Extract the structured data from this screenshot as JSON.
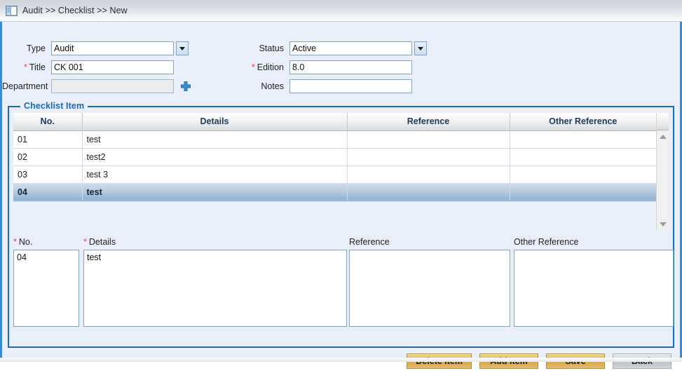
{
  "header": {
    "icon": "window-panel-icon",
    "breadcrumb": "Audit >> Checklist >> New"
  },
  "form": {
    "type": {
      "label": "Type",
      "value": "Audit",
      "required": false,
      "dropdown": true
    },
    "title": {
      "label": "Title",
      "value": "CK 001",
      "required": true,
      "dropdown": false
    },
    "department": {
      "label": "Department",
      "value": "",
      "required": false,
      "disabled": true,
      "add_icon": "plus-icon"
    },
    "status": {
      "label": "Status",
      "value": "Active",
      "required": false,
      "dropdown": true
    },
    "edition": {
      "label": "Edition",
      "value": "8.0",
      "required": true,
      "dropdown": false
    },
    "notes": {
      "label": "Notes",
      "value": "",
      "required": false,
      "dropdown": false
    },
    "required_marker": "*"
  },
  "fieldset": {
    "legend": "Checklist Item"
  },
  "grid": {
    "columns": [
      "No.",
      "Details",
      "Reference",
      "Other Reference"
    ],
    "rows": [
      {
        "no": "01",
        "details": "test",
        "reference": "",
        "other_reference": "",
        "selected": false
      },
      {
        "no": "02",
        "details": "test2",
        "reference": "",
        "other_reference": "",
        "selected": false
      },
      {
        "no": "03",
        "details": "test 3",
        "reference": "",
        "other_reference": "",
        "selected": false
      },
      {
        "no": "04",
        "details": "test",
        "reference": "",
        "other_reference": "",
        "selected": true
      }
    ],
    "scrollbar": {
      "up_icon": "triangle-up-icon",
      "down_icon": "triangle-down-icon"
    }
  },
  "edit": {
    "no": {
      "label": "No.",
      "value": "04",
      "required": true
    },
    "details": {
      "label": "Details",
      "value": "test",
      "required": true
    },
    "reference": {
      "label": "Reference",
      "value": "",
      "required": false
    },
    "other_reference": {
      "label": "Other Reference",
      "value": "",
      "required": false
    }
  },
  "buttons": {
    "delete_item": "Delete Item",
    "add_item": "Add Item",
    "save": "Save",
    "back": "Back"
  },
  "colors": {
    "accent_blue": "#1a6bb5",
    "body_bg": "#e9eef8",
    "required_red": "#e0434c",
    "button_gold": "#d9a53f",
    "button_gray": "#bdc1c6",
    "row_selected": "#8cafd0"
  }
}
